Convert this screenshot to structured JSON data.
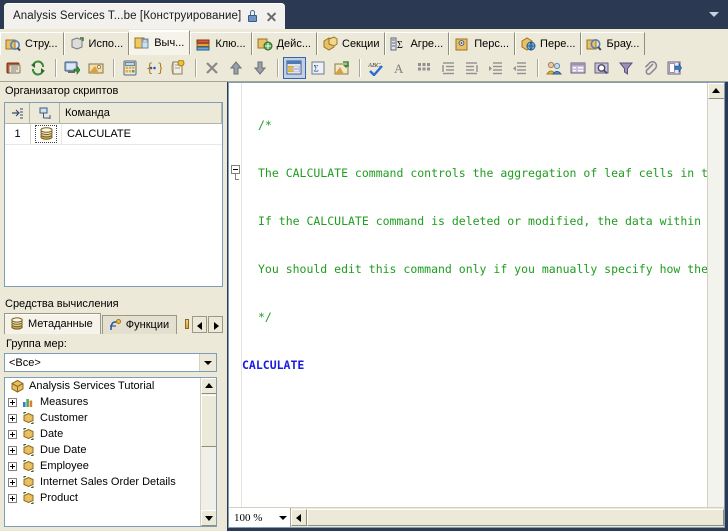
{
  "window": {
    "document_tab_title": "Analysis Services T...be [Конструирование]",
    "lock_icon": "lock-icon",
    "close_icon": "close-icon",
    "tab_menu_icon": "chevron-down-icon"
  },
  "designer_tabs": [
    {
      "label": "Стру...",
      "icon": "cube-structure-icon",
      "active": false
    },
    {
      "label": "Испо...",
      "icon": "dimension-usage-icon",
      "active": false
    },
    {
      "label": "Выч...",
      "icon": "calculations-icon",
      "active": true
    },
    {
      "label": "Клю...",
      "icon": "kpi-icon",
      "active": false
    },
    {
      "label": "Дейс...",
      "icon": "actions-icon",
      "active": false
    },
    {
      "label": "Секции",
      "icon": "partitions-icon",
      "active": false
    },
    {
      "label": "Агре...",
      "icon": "aggregations-icon",
      "active": false
    },
    {
      "label": "Перс...",
      "icon": "perspectives-icon",
      "active": false
    },
    {
      "label": "Пере...",
      "icon": "translations-icon",
      "active": false
    },
    {
      "label": "Брау...",
      "icon": "browser-icon",
      "active": false
    }
  ],
  "toolbar": {
    "buttons": [
      {
        "name": "new-script-command-icon",
        "group": 0
      },
      {
        "name": "refresh-icon",
        "group": 0
      },
      {
        "name": "process-icon",
        "group": 1
      },
      {
        "name": "deploy-icon",
        "group": 1
      },
      {
        "name": "new-calculated-member-icon",
        "group": 2
      },
      {
        "name": "new-named-set-icon",
        "group": 2
      },
      {
        "name": "new-script-command-2-icon",
        "group": 2
      },
      {
        "name": "delete-icon",
        "group": 3
      },
      {
        "name": "move-up-icon",
        "group": 3
      },
      {
        "name": "move-down-icon",
        "group": 3
      },
      {
        "name": "form-view-icon",
        "group": 4,
        "selected": true
      },
      {
        "name": "script-view-icon",
        "group": 4
      },
      {
        "name": "calculation-properties-icon",
        "group": 4
      },
      {
        "name": "check-syntax-icon",
        "group": 5
      },
      {
        "name": "font-icon",
        "group": 5
      },
      {
        "name": "grid-icon",
        "group": 5
      },
      {
        "name": "indent-left-icon",
        "group": 5
      },
      {
        "name": "indent-right-icon",
        "group": 5
      },
      {
        "name": "increase-indent-icon",
        "group": 5
      },
      {
        "name": "decrease-indent-icon",
        "group": 5
      },
      {
        "name": "roles-icon",
        "group": 6
      },
      {
        "name": "properties-window-icon",
        "group": 6
      },
      {
        "name": "zoom-icon",
        "group": 6
      },
      {
        "name": "filter-icon",
        "group": 6
      },
      {
        "name": "attach-icon",
        "group": 6
      },
      {
        "name": "export-icon",
        "group": 6
      }
    ]
  },
  "script_organizer": {
    "title": "Организатор скриптов",
    "columns": [
      {
        "label": "",
        "icon": "row-selector-icon"
      },
      {
        "label": "",
        "icon": "script-type-icon"
      },
      {
        "label": "Команда"
      }
    ],
    "rows": [
      {
        "num": "1",
        "icon": "script-command-icon",
        "command": "CALCULATE"
      }
    ]
  },
  "calculation_tools": {
    "title": "Средства вычисления",
    "tabs": [
      {
        "label": "Метаданные",
        "icon": "metadata-icon",
        "active": true
      },
      {
        "label": "Функции",
        "icon": "functions-icon",
        "active": false
      }
    ],
    "scroll_left_icon": "scroll-left-icon",
    "scroll_right_icon": "scroll-right-icon",
    "pin_icon": "pin-icon",
    "measure_group_label": "Группа мер:",
    "measure_group_value": "<Все>",
    "tree": [
      {
        "label": "Analysis Services Tutorial",
        "icon": "cube-icon",
        "level": 0,
        "expandable": false
      },
      {
        "label": "Measures",
        "icon": "measures-icon",
        "level": 1,
        "expandable": true
      },
      {
        "label": "Customer",
        "icon": "dimension-icon",
        "level": 1,
        "expandable": true
      },
      {
        "label": "Date",
        "icon": "dimension-icon",
        "level": 1,
        "expandable": true
      },
      {
        "label": "Due Date",
        "icon": "dimension-icon",
        "level": 1,
        "expandable": true
      },
      {
        "label": "Employee",
        "icon": "dimension-icon",
        "level": 1,
        "expandable": true
      },
      {
        "label": "Internet Sales Order Details",
        "icon": "dimension-icon",
        "level": 1,
        "expandable": true
      },
      {
        "label": "Product",
        "icon": "dimension-icon",
        "level": 1,
        "expandable": true
      }
    ]
  },
  "editor": {
    "lines": [
      {
        "text": "/*",
        "style": "comment",
        "indent": 1
      },
      {
        "text": "The CALCULATE command controls the aggregation of leaf cells in th",
        "style": "comment",
        "indent": 1
      },
      {
        "text": "If the CALCULATE command is deleted or modified, the data within t",
        "style": "comment",
        "indent": 1
      },
      {
        "text": "You should edit this command only if you manually specify how the ",
        "style": "comment",
        "indent": 1
      },
      {
        "text": "*/",
        "style": "comment",
        "indent": 1
      },
      {
        "text": "CALCULATE",
        "style": "keyword",
        "indent": 0
      }
    ],
    "collapse_icon": "collapse-minus-icon",
    "zoom_level": "100 %",
    "zoom_dropdown_icon": "chevron-down-icon",
    "hscroll_left_icon": "scroll-left-icon",
    "vscroll_up_icon": "scroll-up-icon"
  }
}
